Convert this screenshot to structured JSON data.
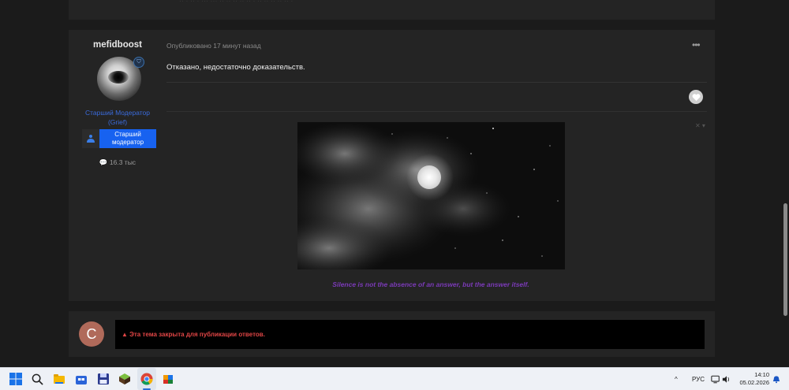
{
  "previous_post": {
    "fragment": "·· · ·· · ··· ··· ·· ·· ·· ·· ·· · ·· ·· ·· ·· ·· ·"
  },
  "post": {
    "author": "mefidboost",
    "role_line1": "Старший Модератор",
    "role_line2": "(Grief)",
    "rank_line1": "Старший",
    "rank_line2": "модератор",
    "posts_count": "16.3 тыс",
    "meta": "Опубликовано 17 минут назад",
    "more": "•••",
    "text": "Отказано, недостаточно доказательств.",
    "signature_close": "✕ ▾",
    "signature_text": "Silence is not the absence of an answer, but the answer itself."
  },
  "closed": {
    "avatar_letter": "C",
    "message": "Эта тема закрыта для публикации ответов."
  },
  "taskbar": {
    "language": "РУС",
    "time": "14:10",
    "date": "05.02.2026",
    "chevron": "^"
  },
  "colors": {
    "accent_blue": "#1762f0",
    "role_blue": "#3a6bdc",
    "signature_purple": "#7b3ab8",
    "closed_red": "#e04545"
  },
  "icons": [
    "windows-start-icon",
    "search-icon",
    "file-explorer-icon",
    "store-icon",
    "save-icon",
    "cube-icon",
    "chrome-icon",
    "paint-icon",
    "chevron-up-icon",
    "network-icon",
    "volume-icon",
    "notification-icon",
    "heart-icon",
    "badge-icon"
  ]
}
